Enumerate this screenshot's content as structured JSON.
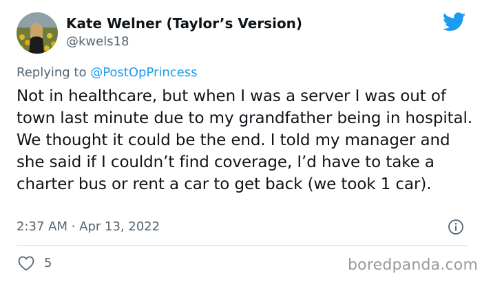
{
  "author": {
    "display_name": "Kate Welner (Taylor’s Version)",
    "handle": "@kwels18"
  },
  "reply_context": {
    "prefix": "Replying to ",
    "mention": "@PostOpPrincess"
  },
  "tweet": {
    "text": "Not in healthcare, but when I was a server I was out of town last minute due to my grandfather being in hospital. We thought it could be the end. I told my manager and she said if I couldn’t find coverage, I’d have to take a charter bus or rent a car to get back (we took 1 car).",
    "timestamp": "2:37 AM · Apr 13, 2022"
  },
  "actions": {
    "like_count": "5"
  },
  "watermark": "boredpanda.com",
  "icons": {
    "brand": "twitter-bird-icon",
    "info": "info-icon",
    "like": "heart-icon"
  },
  "colors": {
    "text": "#0f1419",
    "secondary_text": "#536471",
    "link": "#1d9bf0",
    "twitter_blue": "#1d9bf0",
    "divider": "#cfd9de"
  }
}
